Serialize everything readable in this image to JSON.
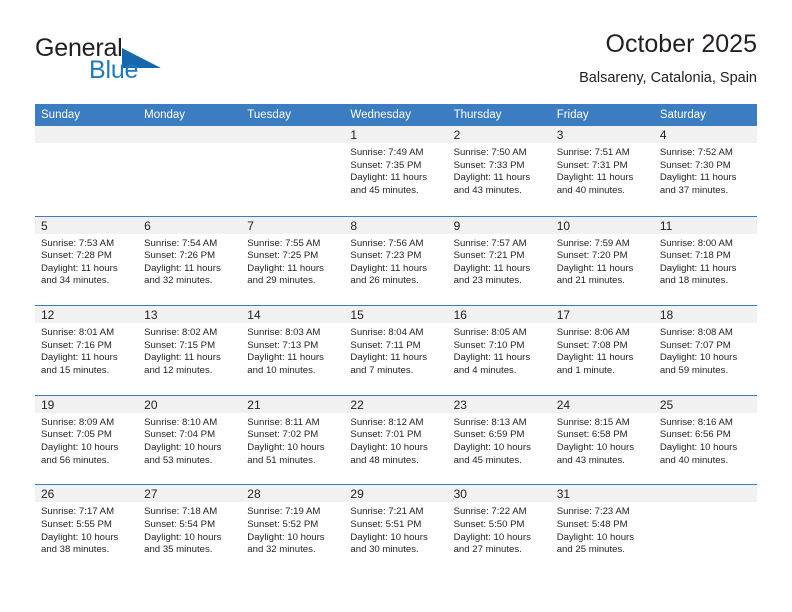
{
  "brand": {
    "name_part1": "General",
    "name_part2": "Blue",
    "triangle_color": "#1668ad",
    "blue_color": "#1c7ac0"
  },
  "header": {
    "title": "October 2025",
    "subtitle": "Balsareny, Catalonia, Spain"
  },
  "theme": {
    "header_blue": "#3b7dc0",
    "band_grey": "#f1f1f1",
    "text_color": "#231f20"
  },
  "weekdays": [
    "Sunday",
    "Monday",
    "Tuesday",
    "Wednesday",
    "Thursday",
    "Friday",
    "Saturday"
  ],
  "labels": {
    "sunrise": "Sunrise:",
    "sunset": "Sunset:",
    "daylight": "Daylight:"
  },
  "weeks": [
    [
      {
        "day": "",
        "empty": true
      },
      {
        "day": "",
        "empty": true
      },
      {
        "day": "",
        "empty": true
      },
      {
        "day": "1",
        "sunrise": "Sunrise: 7:49 AM",
        "sunset": "Sunset: 7:35 PM",
        "daylight": "Daylight: 11 hours and 45 minutes."
      },
      {
        "day": "2",
        "sunrise": "Sunrise: 7:50 AM",
        "sunset": "Sunset: 7:33 PM",
        "daylight": "Daylight: 11 hours and 43 minutes."
      },
      {
        "day": "3",
        "sunrise": "Sunrise: 7:51 AM",
        "sunset": "Sunset: 7:31 PM",
        "daylight": "Daylight: 11 hours and 40 minutes."
      },
      {
        "day": "4",
        "sunrise": "Sunrise: 7:52 AM",
        "sunset": "Sunset: 7:30 PM",
        "daylight": "Daylight: 11 hours and 37 minutes."
      }
    ],
    [
      {
        "day": "5",
        "sunrise": "Sunrise: 7:53 AM",
        "sunset": "Sunset: 7:28 PM",
        "daylight": "Daylight: 11 hours and 34 minutes."
      },
      {
        "day": "6",
        "sunrise": "Sunrise: 7:54 AM",
        "sunset": "Sunset: 7:26 PM",
        "daylight": "Daylight: 11 hours and 32 minutes."
      },
      {
        "day": "7",
        "sunrise": "Sunrise: 7:55 AM",
        "sunset": "Sunset: 7:25 PM",
        "daylight": "Daylight: 11 hours and 29 minutes."
      },
      {
        "day": "8",
        "sunrise": "Sunrise: 7:56 AM",
        "sunset": "Sunset: 7:23 PM",
        "daylight": "Daylight: 11 hours and 26 minutes."
      },
      {
        "day": "9",
        "sunrise": "Sunrise: 7:57 AM",
        "sunset": "Sunset: 7:21 PM",
        "daylight": "Daylight: 11 hours and 23 minutes."
      },
      {
        "day": "10",
        "sunrise": "Sunrise: 7:59 AM",
        "sunset": "Sunset: 7:20 PM",
        "daylight": "Daylight: 11 hours and 21 minutes."
      },
      {
        "day": "11",
        "sunrise": "Sunrise: 8:00 AM",
        "sunset": "Sunset: 7:18 PM",
        "daylight": "Daylight: 11 hours and 18 minutes."
      }
    ],
    [
      {
        "day": "12",
        "sunrise": "Sunrise: 8:01 AM",
        "sunset": "Sunset: 7:16 PM",
        "daylight": "Daylight: 11 hours and 15 minutes."
      },
      {
        "day": "13",
        "sunrise": "Sunrise: 8:02 AM",
        "sunset": "Sunset: 7:15 PM",
        "daylight": "Daylight: 11 hours and 12 minutes."
      },
      {
        "day": "14",
        "sunrise": "Sunrise: 8:03 AM",
        "sunset": "Sunset: 7:13 PM",
        "daylight": "Daylight: 11 hours and 10 minutes."
      },
      {
        "day": "15",
        "sunrise": "Sunrise: 8:04 AM",
        "sunset": "Sunset: 7:11 PM",
        "daylight": "Daylight: 11 hours and 7 minutes."
      },
      {
        "day": "16",
        "sunrise": "Sunrise: 8:05 AM",
        "sunset": "Sunset: 7:10 PM",
        "daylight": "Daylight: 11 hours and 4 minutes."
      },
      {
        "day": "17",
        "sunrise": "Sunrise: 8:06 AM",
        "sunset": "Sunset: 7:08 PM",
        "daylight": "Daylight: 11 hours and 1 minute."
      },
      {
        "day": "18",
        "sunrise": "Sunrise: 8:08 AM",
        "sunset": "Sunset: 7:07 PM",
        "daylight": "Daylight: 10 hours and 59 minutes."
      }
    ],
    [
      {
        "day": "19",
        "sunrise": "Sunrise: 8:09 AM",
        "sunset": "Sunset: 7:05 PM",
        "daylight": "Daylight: 10 hours and 56 minutes."
      },
      {
        "day": "20",
        "sunrise": "Sunrise: 8:10 AM",
        "sunset": "Sunset: 7:04 PM",
        "daylight": "Daylight: 10 hours and 53 minutes."
      },
      {
        "day": "21",
        "sunrise": "Sunrise: 8:11 AM",
        "sunset": "Sunset: 7:02 PM",
        "daylight": "Daylight: 10 hours and 51 minutes."
      },
      {
        "day": "22",
        "sunrise": "Sunrise: 8:12 AM",
        "sunset": "Sunset: 7:01 PM",
        "daylight": "Daylight: 10 hours and 48 minutes."
      },
      {
        "day": "23",
        "sunrise": "Sunrise: 8:13 AM",
        "sunset": "Sunset: 6:59 PM",
        "daylight": "Daylight: 10 hours and 45 minutes."
      },
      {
        "day": "24",
        "sunrise": "Sunrise: 8:15 AM",
        "sunset": "Sunset: 6:58 PM",
        "daylight": "Daylight: 10 hours and 43 minutes."
      },
      {
        "day": "25",
        "sunrise": "Sunrise: 8:16 AM",
        "sunset": "Sunset: 6:56 PM",
        "daylight": "Daylight: 10 hours and 40 minutes."
      }
    ],
    [
      {
        "day": "26",
        "sunrise": "Sunrise: 7:17 AM",
        "sunset": "Sunset: 5:55 PM",
        "daylight": "Daylight: 10 hours and 38 minutes."
      },
      {
        "day": "27",
        "sunrise": "Sunrise: 7:18 AM",
        "sunset": "Sunset: 5:54 PM",
        "daylight": "Daylight: 10 hours and 35 minutes."
      },
      {
        "day": "28",
        "sunrise": "Sunrise: 7:19 AM",
        "sunset": "Sunset: 5:52 PM",
        "daylight": "Daylight: 10 hours and 32 minutes."
      },
      {
        "day": "29",
        "sunrise": "Sunrise: 7:21 AM",
        "sunset": "Sunset: 5:51 PM",
        "daylight": "Daylight: 10 hours and 30 minutes."
      },
      {
        "day": "30",
        "sunrise": "Sunrise: 7:22 AM",
        "sunset": "Sunset: 5:50 PM",
        "daylight": "Daylight: 10 hours and 27 minutes."
      },
      {
        "day": "31",
        "sunrise": "Sunrise: 7:23 AM",
        "sunset": "Sunset: 5:48 PM",
        "daylight": "Daylight: 10 hours and 25 minutes."
      },
      {
        "day": "",
        "empty": true
      }
    ]
  ]
}
